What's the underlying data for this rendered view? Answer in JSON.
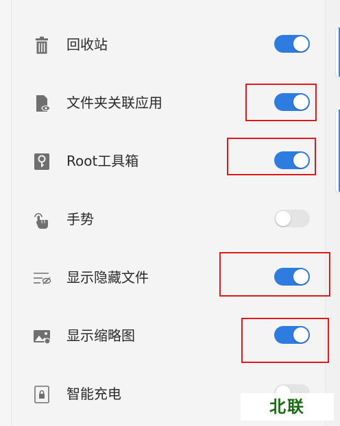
{
  "settings": {
    "items": [
      {
        "label": "回收站",
        "icon": "trash-icon",
        "enabled": true
      },
      {
        "label": "文件夹关联应用",
        "icon": "folder-eye-icon",
        "enabled": true
      },
      {
        "label": "Root工具箱",
        "icon": "key-icon",
        "enabled": true
      },
      {
        "label": "手势",
        "icon": "hand-gesture-icon",
        "enabled": false
      },
      {
        "label": "显示隐藏文件",
        "icon": "hidden-files-icon",
        "enabled": true
      },
      {
        "label": "显示缩略图",
        "icon": "thumbnail-icon",
        "enabled": true
      },
      {
        "label": "智能充电",
        "icon": "lock-icon",
        "enabled": false
      }
    ]
  },
  "watermark": {
    "text": "北联"
  },
  "colors": {
    "toggle_on": "#2f7ce0",
    "toggle_off": "#e4e4e4",
    "highlight": "#e01818",
    "watermark": "#1a6a14"
  }
}
